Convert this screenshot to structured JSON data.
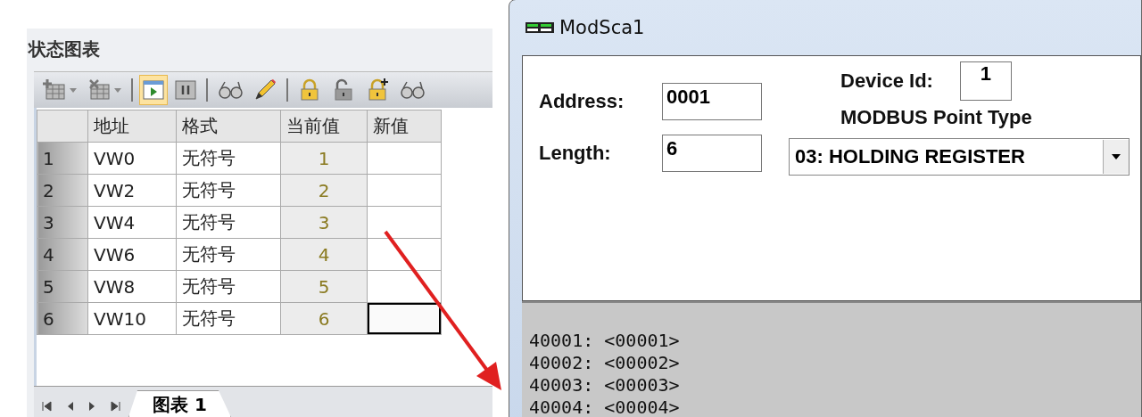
{
  "status_chart": {
    "title": "状态图表",
    "toolbar": [
      {
        "kind": "add-table",
        "dropdown": true,
        "selected": false
      },
      {
        "kind": "delete-table",
        "dropdown": true,
        "selected": false
      },
      {
        "kind": "play",
        "dropdown": false,
        "selected": true
      },
      {
        "kind": "pause",
        "dropdown": false,
        "selected": false
      },
      {
        "kind": "glasses",
        "dropdown": false,
        "selected": false
      },
      {
        "kind": "pencil",
        "dropdown": false,
        "selected": false
      },
      {
        "kind": "lock",
        "dropdown": false,
        "selected": false
      },
      {
        "kind": "unlock",
        "dropdown": false,
        "selected": false
      },
      {
        "kind": "lock-add",
        "dropdown": false,
        "selected": false
      },
      {
        "kind": "glasses-lock",
        "dropdown": false,
        "selected": false
      }
    ],
    "table": {
      "columns": [
        "地址",
        "格式",
        "当前值",
        "新值"
      ],
      "rows": [
        {
          "index": "1",
          "address": "VW0",
          "format": "无符号",
          "value": "1",
          "selected": false
        },
        {
          "index": "2",
          "address": "VW2",
          "format": "无符号",
          "value": "2",
          "selected": false
        },
        {
          "index": "3",
          "address": "VW4",
          "format": "无符号",
          "value": "3",
          "selected": false
        },
        {
          "index": "4",
          "address": "VW6",
          "format": "无符号",
          "value": "4",
          "selected": false
        },
        {
          "index": "5",
          "address": "VW8",
          "format": "无符号",
          "value": "5",
          "selected": false
        },
        {
          "index": "6",
          "address": "VW10",
          "format": "无符号",
          "value": "6",
          "selected": true
        }
      ]
    },
    "tabs": [
      {
        "label": "图表 1",
        "selected": true
      }
    ]
  },
  "modscan_window": {
    "title": "ModSca1",
    "address": {
      "label": "Address:",
      "value": "0001"
    },
    "length": {
      "label": "Length:",
      "value": "6"
    },
    "device_id": {
      "label": "Device Id:",
      "value": "1"
    },
    "point_type": {
      "label": "MODBUS Point Type",
      "value": "03: HOLDING REGISTER"
    },
    "data_lines": [
      "40001: <00001>",
      "40002: <00002>",
      "40003: <00003>",
      "40004: <00004>"
    ]
  }
}
